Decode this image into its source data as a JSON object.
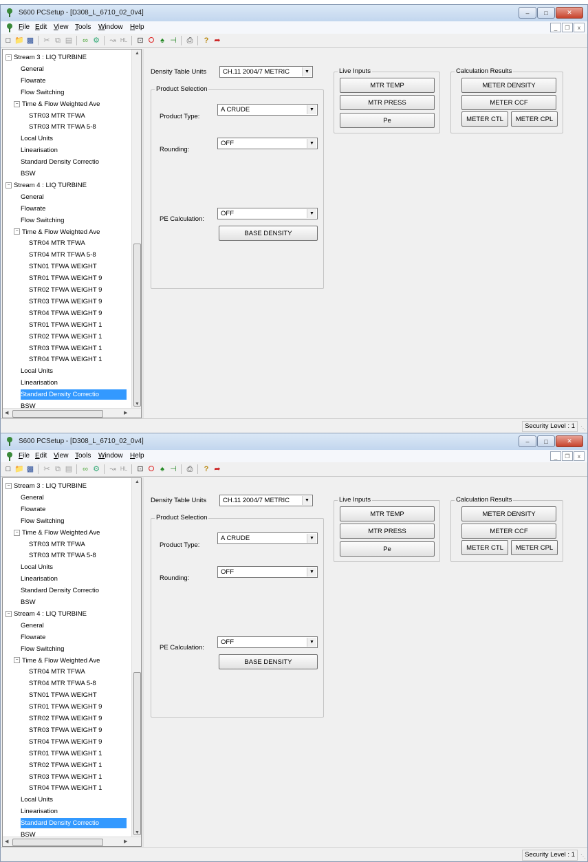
{
  "title": "S600 PCSetup  - [D308_L_6710_02_0v4]",
  "window_buttons": {
    "minimize": "–",
    "maximize": "□",
    "close": "✕"
  },
  "mdi_buttons": {
    "minimize": "_",
    "restore": "❐",
    "close": "x"
  },
  "menu": [
    "File",
    "Edit",
    "View",
    "Tools",
    "Window",
    "Help"
  ],
  "toolbar_icons": [
    "new-icon",
    "open-icon",
    "save-icon",
    "cut-icon",
    "copy-icon",
    "paste-icon",
    "link-icon",
    "find-icon",
    "compare-icon",
    "hl-icon",
    "connect-icon",
    "stop-icon",
    "transfer-icon",
    "upload-icon",
    "print-icon",
    "help-icon",
    "arrow-icon"
  ],
  "tree": [
    {
      "label": "Stream 3 : LIQ TURBINE",
      "level": 0,
      "expander": "−"
    },
    {
      "label": "General",
      "level": 1
    },
    {
      "label": "Flowrate",
      "level": 1
    },
    {
      "label": "Flow Switching",
      "level": 1
    },
    {
      "label": "Time & Flow Weighted Ave",
      "level": 1,
      "expander": "−"
    },
    {
      "label": "STR03 MTR TFWA",
      "level": 2
    },
    {
      "label": "STR03 MTR TFWA 5-8",
      "level": 2
    },
    {
      "label": "Local Units",
      "level": 1
    },
    {
      "label": "Linearisation",
      "level": 1
    },
    {
      "label": "Standard Density Correctio",
      "level": 1
    },
    {
      "label": "BSW",
      "level": 1
    },
    {
      "label": "Stream 4 : LIQ TURBINE",
      "level": 0,
      "expander": "−"
    },
    {
      "label": "General",
      "level": 1
    },
    {
      "label": "Flowrate",
      "level": 1
    },
    {
      "label": "Flow Switching",
      "level": 1
    },
    {
      "label": "Time & Flow Weighted Ave",
      "level": 1,
      "expander": "−"
    },
    {
      "label": "STR04 MTR TFWA",
      "level": 2
    },
    {
      "label": "STR04 MTR TFWA 5-8",
      "level": 2
    },
    {
      "label": "STN01 TFWA WEIGHT",
      "level": 2
    },
    {
      "label": "STR01 TFWA WEIGHT 9",
      "level": 2
    },
    {
      "label": "STR02 TFWA WEIGHT 9",
      "level": 2
    },
    {
      "label": "STR03 TFWA WEIGHT 9",
      "level": 2
    },
    {
      "label": "STR04 TFWA WEIGHT 9",
      "level": 2
    },
    {
      "label": "STR01 TFWA WEIGHT 1",
      "level": 2
    },
    {
      "label": "STR02 TFWA WEIGHT 1",
      "level": 2
    },
    {
      "label": "STR03 TFWA WEIGHT 1",
      "level": 2
    },
    {
      "label": "STR04 TFWA WEIGHT 1",
      "level": 2
    },
    {
      "label": "Local Units",
      "level": 1
    },
    {
      "label": "Linearisation",
      "level": 1
    },
    {
      "label": "Standard Density Correctio",
      "level": 1,
      "selected": true
    },
    {
      "label": "BSW",
      "level": 1
    }
  ],
  "density_table_units": {
    "label": "Density Table Units",
    "value": "CH.11 2004/7 METRIC"
  },
  "product_selection": {
    "title": "Product Selection",
    "product_type": {
      "label": "Product Type:",
      "value": "A CRUDE"
    },
    "rounding": {
      "label": "Rounding:",
      "value": "OFF"
    },
    "pe_calculation": {
      "label": "PE Calculation:",
      "value": "OFF"
    },
    "base_density_button": "BASE DENSITY"
  },
  "live_inputs": {
    "title": "Live Inputs",
    "buttons": [
      "MTR TEMP",
      "MTR PRESS",
      "Pe"
    ]
  },
  "calculation_results": {
    "title": "Calculation Results",
    "meter_density": "METER DENSITY",
    "meter_ccf": "METER CCF",
    "meter_ctl": "METER CTL",
    "meter_cpl": "METER CPL"
  },
  "status": {
    "security": "Security Level : 1"
  },
  "colors": {
    "selection": "#3399ff",
    "title_gradient_top": "#dbe8f6",
    "close_button": "#c7432c"
  }
}
